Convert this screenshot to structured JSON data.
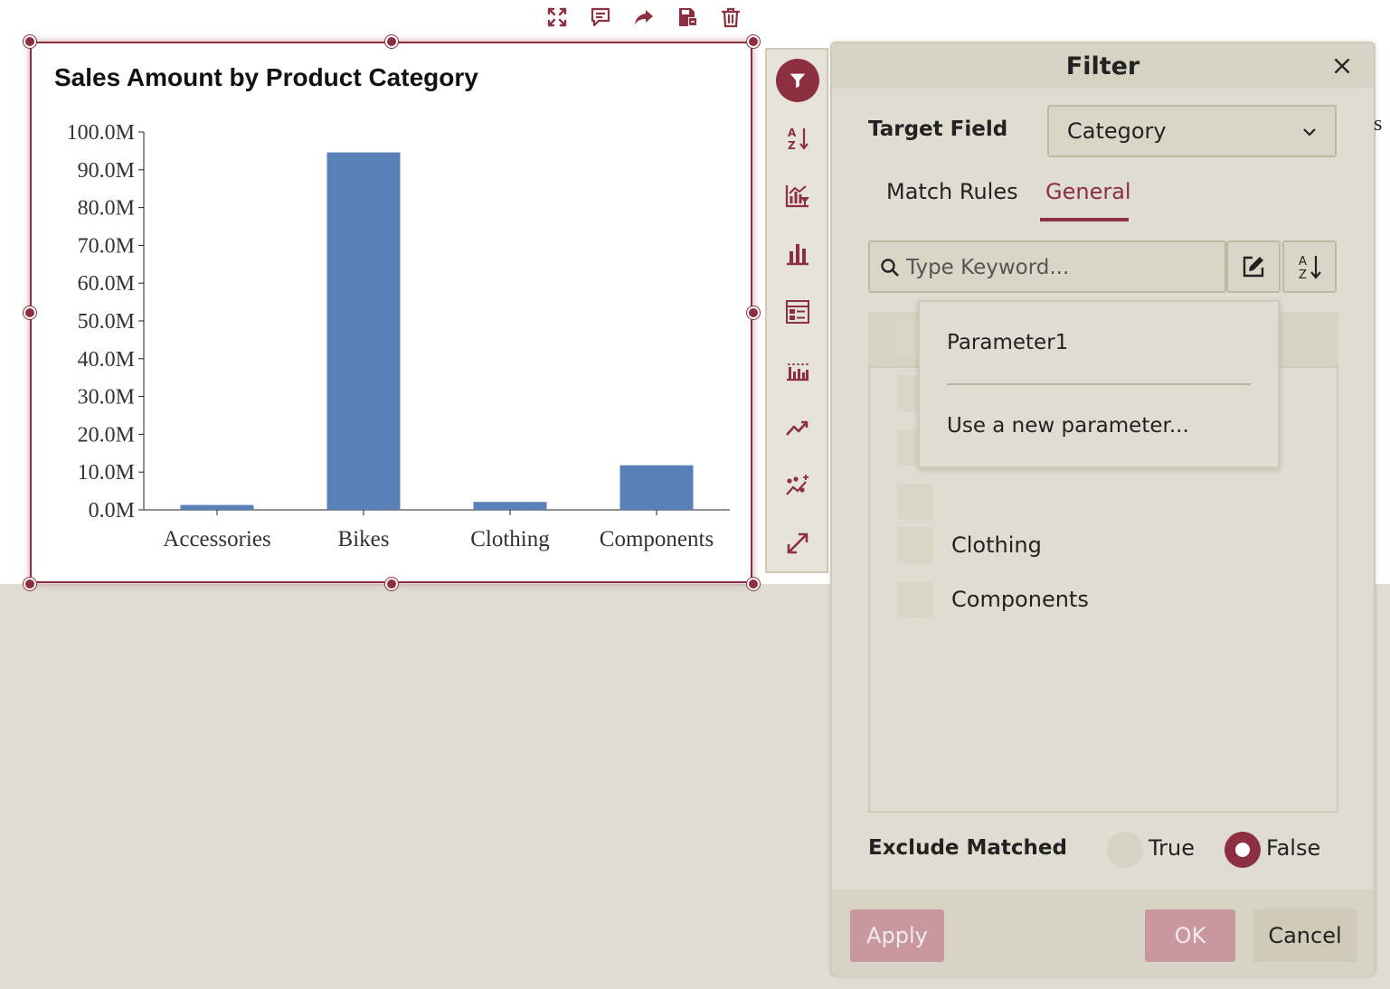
{
  "toolbar": {
    "icons": [
      "expand-icon",
      "comment-icon",
      "share-icon",
      "save-icon",
      "trash-icon"
    ]
  },
  "chart_data": {
    "type": "bar",
    "title": "Sales Amount by Product Category",
    "categories": [
      "Accessories",
      "Bikes",
      "Clothing",
      "Components"
    ],
    "values": [
      1.3,
      94.6,
      2.1,
      11.8
    ],
    "unit_suffix": "M",
    "ylim": [
      0,
      100
    ],
    "yticks": [
      "100.0M",
      "90.0M",
      "80.0M",
      "70.0M",
      "60.0M",
      "50.0M",
      "40.0M",
      "30.0M",
      "20.0M",
      "10.0M",
      "0.0M"
    ],
    "xlabel": "",
    "ylabel": "",
    "bar_color": "#5a80b8",
    "grid": false
  },
  "rail": {
    "icons": [
      "filter-icon",
      "sort-icon",
      "chart-filter-icon",
      "bar-chart-icon",
      "form-icon",
      "histogram-icon",
      "trend-icon",
      "sparkle-trend-icon",
      "resize-icon"
    ]
  },
  "filter": {
    "title": "Filter",
    "target_field_label": "Target Field",
    "target_field_value": "Category",
    "tabs": [
      "Match Rules",
      "General"
    ],
    "active_tab": "General",
    "search_placeholder": "Type Keyword...",
    "list_items": [
      "Clothing",
      "Components"
    ],
    "exclude_label": "Exclude Matched",
    "radio_true": "True",
    "radio_false": "False",
    "selected": "False",
    "buttons": {
      "apply": "Apply",
      "ok": "OK",
      "cancel": "Cancel"
    }
  },
  "popup": {
    "items": [
      "Parameter1",
      "Use a new parameter..."
    ]
  },
  "edge_text": "s",
  "colors": {
    "accent": "#8c2f41",
    "panel": "#dfddd1",
    "bar": "#5a80b8"
  }
}
